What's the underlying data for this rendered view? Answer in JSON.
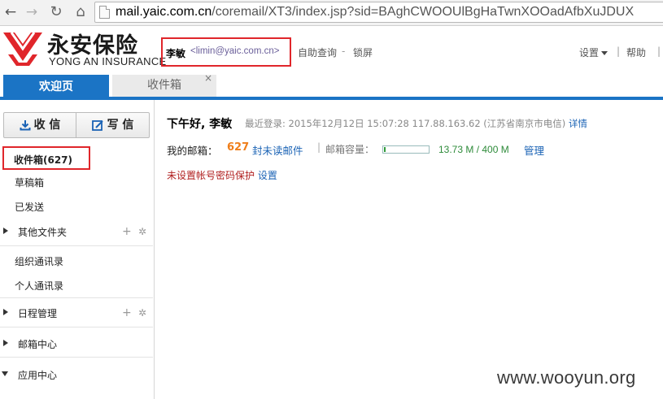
{
  "browser": {
    "back_icon": "arrow-left-icon",
    "forward_icon": "arrow-right-icon",
    "reload_icon": "reload-icon",
    "home_icon": "home-icon",
    "url_host": "mail.yaic.com.cn",
    "url_path": "/coremail/XT3/index.jsp?sid=BAghCWOOUlBgHaTwnXOOadAfbXuJDUX"
  },
  "header": {
    "logo_cn": "永安保险",
    "logo_en": "YONG AN INSURANCE",
    "user_name": "李敏",
    "user_email": "<limin@yaic.com.cn>",
    "self_service": "自助查询",
    "dash": "-",
    "lock_screen": "锁屏",
    "settings": "设置",
    "help": "帮助",
    "sep": "|",
    "brand_color": "#e0262b",
    "accent_color": "#1b74c5"
  },
  "tabs": [
    {
      "label": "欢迎页",
      "active": true
    },
    {
      "label": "收件箱",
      "active": false,
      "close": "×"
    }
  ],
  "sidebar": {
    "receive_label": "收 信",
    "compose_label": "写 信",
    "inbox_label": "收件箱(627)",
    "drafts_label": "草稿箱",
    "sent_label": "已发送",
    "other_folders_label": "其他文件夹",
    "org_contacts_label": "组织通讯录",
    "personal_contacts_label": "个人通讯录",
    "calendar_label": "日程管理",
    "mailbox_center_label": "邮箱中心",
    "app_center_label": "应用中心",
    "plus": "+",
    "gear": "✲"
  },
  "main": {
    "greeting": "下午好, 李敏",
    "last_login_prefix": "最近登录: 2015年12月12日 15:07:28 117.88.163.62 (江苏省南京市电信)",
    "detail_link": "详情",
    "mailbox_label": "我的邮箱：",
    "unread_count": "627",
    "unread_link": "封未读邮件",
    "pipe": "|",
    "quota_label": "邮箱容量：",
    "quota_used_fraction": 0.034,
    "quota_text": "13.73 M / 400 M",
    "manage_link": "管理",
    "warn_text": "未设置帐号密码保护",
    "warn_link": "设置"
  },
  "watermark": "www.wooyun.org"
}
